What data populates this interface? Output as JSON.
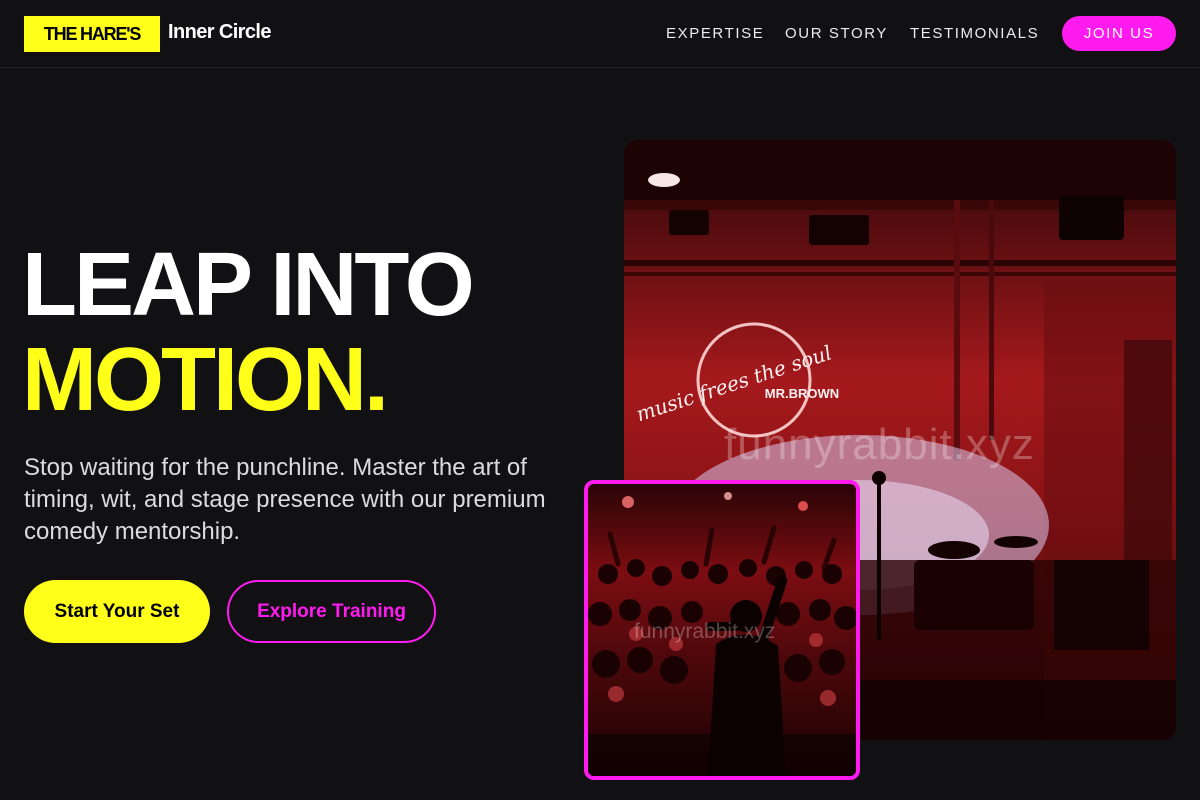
{
  "header": {
    "brand_badge": "THE HARE'S",
    "brand_name": "Inner Circle",
    "nav": [
      {
        "label": "EXPERTISE"
      },
      {
        "label": "OUR STORY"
      },
      {
        "label": "TESTIMONIALS"
      }
    ],
    "cta_label": "JOIN US"
  },
  "hero": {
    "title_line_1": "LEAP INTO",
    "title_line_2": "MOTION.",
    "description": "Stop waiting for the punchline. Master the art of timing, wit, and stage presence with our premium comedy mentorship.",
    "primary_button": "Start Your Set",
    "secondary_button": "Explore Training"
  },
  "images": {
    "main_neon_line_1": "music frees the soul",
    "main_neon_line_2": "MR.BROWN",
    "main_watermark": "funnyrabbit.xyz",
    "crowd_watermark": "funnyrabbit.xyz"
  },
  "colors": {
    "accent_yellow": "#ffff1a",
    "accent_magenta": "#ff1bf0",
    "background": "#111113"
  }
}
